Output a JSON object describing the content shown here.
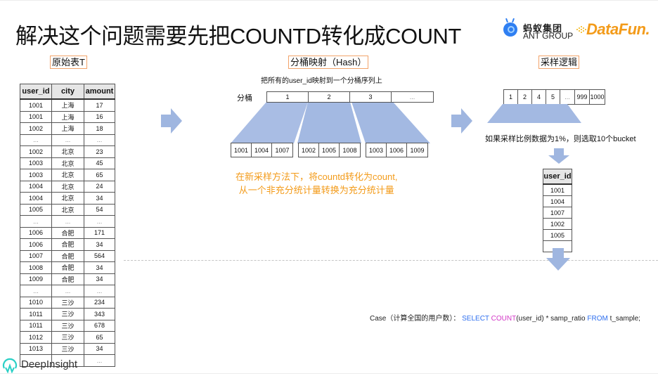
{
  "title": "解决这个问题需要先把COUNTD转化成COUNT",
  "logos": {
    "ant_cn": "蚂蚁集团",
    "ant_en": "ANT GROUP",
    "datafun": "DataFun."
  },
  "colors": {
    "arrow": "#9fb6e0",
    "trapezoid": "#a3b9e2",
    "orange": "#f39b1a",
    "label_border": "#f2a36a",
    "sql_keyword": "#2f6fef",
    "sql_function": "#d237c6"
  },
  "original_table": {
    "label": "原始表T",
    "headers": [
      "user_id",
      "city",
      "amount"
    ],
    "rows": [
      [
        "1001",
        "上海",
        "17"
      ],
      [
        "1001",
        "上海",
        "16"
      ],
      [
        "1002",
        "上海",
        "18"
      ],
      [
        "...",
        "...",
        "..."
      ],
      [
        "1002",
        "北京",
        "23"
      ],
      [
        "1003",
        "北京",
        "45"
      ],
      [
        "1003",
        "北京",
        "65"
      ],
      [
        "1004",
        "北京",
        "24"
      ],
      [
        "1004",
        "北京",
        "34"
      ],
      [
        "1005",
        "北京",
        "54"
      ],
      [
        "...",
        "...",
        "..."
      ],
      [
        "1006",
        "合肥",
        "171"
      ],
      [
        "1006",
        "合肥",
        "34"
      ],
      [
        "1007",
        "合肥",
        "564"
      ],
      [
        "1008",
        "合肥",
        "34"
      ],
      [
        "1009",
        "合肥",
        "34"
      ],
      [
        "...",
        "...",
        "..."
      ],
      [
        "1010",
        "三沙",
        "234"
      ],
      [
        "1011",
        "三沙",
        "343"
      ],
      [
        "1011",
        "三沙",
        "678"
      ],
      [
        "1012",
        "三沙",
        "65"
      ],
      [
        "1013",
        "三沙",
        "34"
      ],
      [
        "",
        "",
        "..."
      ]
    ]
  },
  "hash": {
    "label": "分桶映射（Hash）",
    "subtitle": "把所有的user_id映射到一个分桶序列上",
    "bucket_label": "分桶",
    "buckets": [
      "1",
      "2",
      "3",
      "..."
    ],
    "groups": [
      [
        "1001",
        "1004",
        "1007"
      ],
      [
        "1002",
        "1005",
        "1008"
      ],
      [
        "1003",
        "1006",
        "1009"
      ]
    ],
    "note_line1": "在新采样方法下，将countd转化为count,",
    "note_line2": "从一个非充分统计量转换为充分统计量"
  },
  "sampling": {
    "label": "采样逻辑",
    "buckets": [
      "1",
      "2",
      "4",
      "5",
      "...",
      "999",
      "1000"
    ],
    "note": "如果采样比例数据为1%，则选取10个bucket",
    "table_header": "user_id",
    "table_rows": [
      "1001",
      "1004",
      "1007",
      "1002",
      "1005",
      "..."
    ]
  },
  "sql": {
    "prefix": "Case（计算全国的用户数）： ",
    "select": "SELECT",
    "count": "COUNT",
    "args": "(user_id) * samp_ratio ",
    "from": "FROM",
    "table": " t_sample;"
  },
  "watermark": "DeepInsight"
}
